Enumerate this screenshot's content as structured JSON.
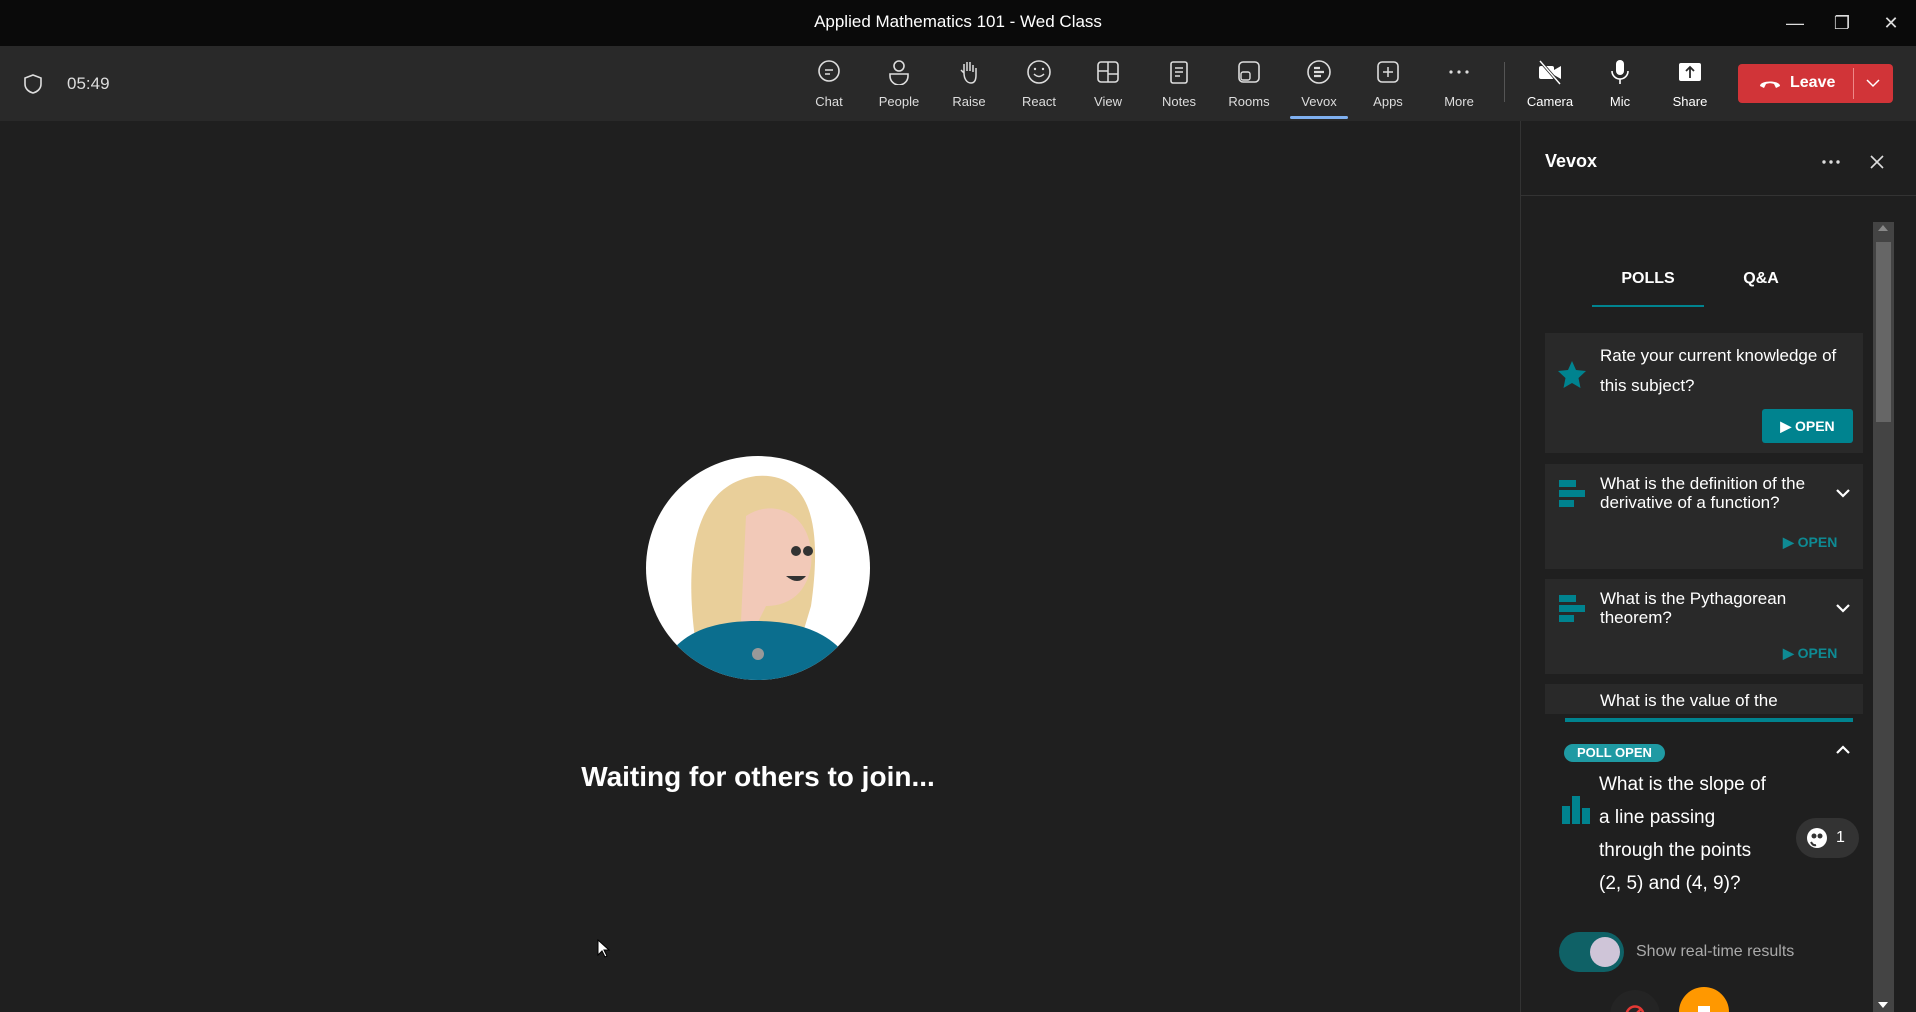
{
  "window": {
    "title": "Applied Mathematics 101 - Wed Class"
  },
  "meeting": {
    "timer": "05:49"
  },
  "toolbar": {
    "items": [
      {
        "label": "Chat",
        "icon": "chat-icon"
      },
      {
        "label": "People",
        "icon": "people-icon"
      },
      {
        "label": "Raise",
        "icon": "hand-icon"
      },
      {
        "label": "React",
        "icon": "smile-icon"
      },
      {
        "label": "View",
        "icon": "grid-icon"
      },
      {
        "label": "Notes",
        "icon": "notes-icon"
      },
      {
        "label": "Rooms",
        "icon": "rooms-icon"
      },
      {
        "label": "Vevox",
        "icon": "vevox-icon",
        "active": true
      },
      {
        "label": "Apps",
        "icon": "plus-icon"
      },
      {
        "label": "More",
        "icon": "more-icon"
      }
    ],
    "devices": [
      {
        "label": "Camera",
        "icon": "camera-off-icon"
      },
      {
        "label": "Mic",
        "icon": "mic-icon"
      },
      {
        "label": "Share",
        "icon": "share-icon"
      }
    ],
    "leave_label": "Leave",
    "accent": "#7fb0f0",
    "leave_color": "#d13438"
  },
  "stage": {
    "waiting_text": "Waiting for others to join..."
  },
  "panel": {
    "title": "Vevox",
    "tabs": [
      {
        "label": "POLLS",
        "active": true
      },
      {
        "label": "Q&A"
      }
    ],
    "polls": [
      {
        "question": "Rate your current knowledge of this subject?",
        "icon": "star-icon",
        "action": "OPEN"
      },
      {
        "question": "What is the definition of the derivative of a function?",
        "icon": "bar-list-icon",
        "action": "OPEN"
      },
      {
        "question": "What is the Pythagorean theorem?",
        "icon": "bar-list-icon",
        "action": "OPEN"
      },
      {
        "question": "What is the value of the"
      }
    ],
    "active_poll": {
      "badge": "POLL OPEN",
      "question_lines": [
        "What is the slope of",
        "a line passing",
        "through the points",
        "(2, 5) and (4, 9)?"
      ],
      "responses": "1",
      "toggle_label": "Show real-time results",
      "toggle_on": true
    },
    "brand_color": "#00838f",
    "stop_color": "#ff9800"
  }
}
